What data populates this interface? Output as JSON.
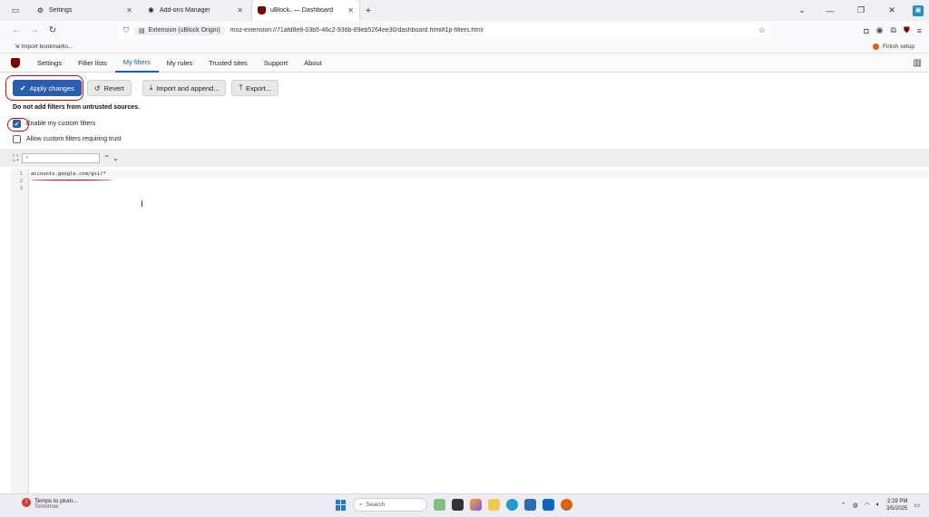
{
  "tabs": [
    {
      "title": "Settings",
      "icon": "gear-icon",
      "active": false
    },
    {
      "title": "Add-ons Manager",
      "icon": "puzzle-icon",
      "active": false
    },
    {
      "title": "uBlock₀ — Dashboard",
      "icon": "ublock-shield-icon",
      "active": true
    }
  ],
  "nav": {
    "identity_label": "Extension (uBlock Origin)",
    "url": "moz-extension://71afd8e8-03b5-46c2-936b-89eb5264ee30/dashboard.html#1p-filters.html"
  },
  "bookmarks": {
    "import_label": "Import bookmarks...",
    "finish_setup_label": "Finish setup"
  },
  "dashboard": {
    "tabs": [
      "Settings",
      "Filter lists",
      "My filters",
      "My rules",
      "Trusted sites",
      "Support",
      "About"
    ],
    "active_tab": "My filters",
    "buttons": {
      "apply": "Apply changes",
      "revert": "Revert",
      "import": "Import and append...",
      "export": "Export..."
    },
    "warning": "Do not add filters from untrusted sources.",
    "checkboxes": [
      {
        "label": "Enable my custom filters",
        "checked": true
      },
      {
        "label": "Allow custom filters requiring trust",
        "checked": false
      }
    ],
    "editor": {
      "line_numbers": [
        "1",
        "2",
        "3"
      ],
      "lines": [
        "accounts.google.com/gsi/*",
        "",
        ""
      ]
    }
  },
  "taskbar": {
    "weather_title": "Temps to plum...",
    "weather_sub": "Tomorrow",
    "search_label": "Search",
    "time": "2:29 PM",
    "date": "3/5/2025"
  },
  "colors": {
    "accent": "#2a5db0",
    "annotation": "#e00000",
    "ublock_red": "#800000"
  }
}
